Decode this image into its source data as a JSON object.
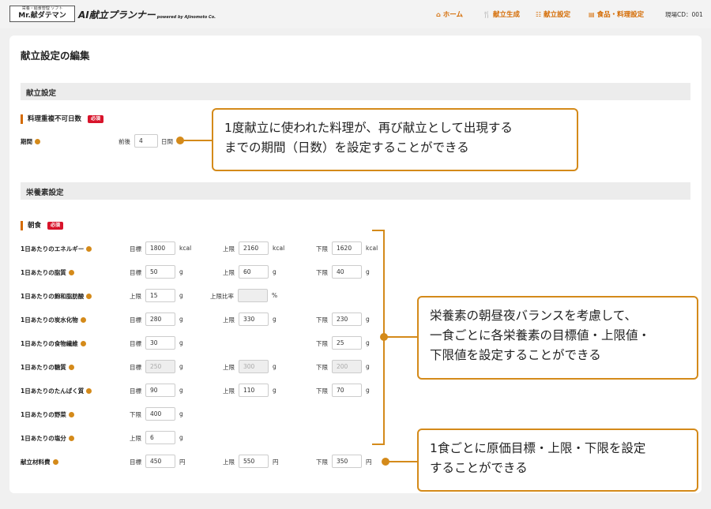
{
  "header": {
    "logo_small": "栄養・給食管理 ソフト",
    "logo_main": "Mr.献ダテマン",
    "app_title": "AI献立プランナー",
    "app_powered": "powered by Ajinomoto Co.",
    "nav": [
      {
        "label": "ホーム",
        "icon": "home-icon",
        "glyph": "⌂"
      },
      {
        "label": "献立生成",
        "icon": "utensils-icon",
        "glyph": "🍴"
      },
      {
        "label": "献立設定",
        "icon": "settings-list-icon",
        "glyph": "☷"
      },
      {
        "label": "食品・料理設定",
        "icon": "food-settings-icon",
        "glyph": "▤"
      }
    ],
    "site_cd": "現場CD：001"
  },
  "page": {
    "title": "献立設定の編集"
  },
  "menu_settings": {
    "heading": "献立設定",
    "sub_heading": "料理重複不可日数",
    "required": "必須",
    "period": {
      "label": "期間",
      "prefix": "前後",
      "value": "4",
      "unit": "日間"
    }
  },
  "nutrition": {
    "heading": "栄養素設定",
    "meal": "朝食",
    "required": "必須",
    "rows": [
      {
        "label": "1日あたりのエネルギー",
        "fields": [
          {
            "label": "目標",
            "value": "1800",
            "unit": "kcal"
          },
          {
            "label": "上限",
            "value": "2160",
            "unit": "kcal"
          },
          {
            "label": "下限",
            "value": "1620",
            "unit": "kcal"
          }
        ]
      },
      {
        "label": "1日あたりの脂質",
        "fields": [
          {
            "label": "目標",
            "value": "50",
            "unit": "g"
          },
          {
            "label": "上限",
            "value": "60",
            "unit": "g"
          },
          {
            "label": "下限",
            "value": "40",
            "unit": "g"
          }
        ]
      },
      {
        "label": "1日あたりの飽和脂肪酸",
        "fields": [
          {
            "label": "上限",
            "value": "15",
            "unit": "g"
          },
          {
            "label": "上限比率",
            "value": "",
            "unit": "%",
            "disabled": true
          }
        ]
      },
      {
        "label": "1日あたりの炭水化物",
        "fields": [
          {
            "label": "目標",
            "value": "280",
            "unit": "g"
          },
          {
            "label": "上限",
            "value": "330",
            "unit": "g"
          },
          {
            "label": "下限",
            "value": "230",
            "unit": "g"
          }
        ]
      },
      {
        "label": "1日あたりの食物繊維",
        "fields": [
          {
            "label": "目標",
            "value": "30",
            "unit": "g"
          },
          {
            "label": "下限",
            "value": "25",
            "unit": "g"
          }
        ]
      },
      {
        "label": "1日あたりの糖質",
        "fields": [
          {
            "label": "目標",
            "value": "250",
            "unit": "g",
            "disabled": true
          },
          {
            "label": "上限",
            "value": "300",
            "unit": "g",
            "disabled": true
          },
          {
            "label": "下限",
            "value": "200",
            "unit": "g",
            "disabled": true
          }
        ]
      },
      {
        "label": "1日あたりのたんぱく質",
        "fields": [
          {
            "label": "目標",
            "value": "90",
            "unit": "g"
          },
          {
            "label": "上限",
            "value": "110",
            "unit": "g"
          },
          {
            "label": "下限",
            "value": "70",
            "unit": "g"
          }
        ]
      },
      {
        "label": "1日あたりの野菜",
        "fields": [
          {
            "label": "下限",
            "value": "400",
            "unit": "g"
          }
        ]
      },
      {
        "label": "1日あたりの塩分",
        "fields": [
          {
            "label": "上限",
            "value": "6",
            "unit": "g"
          }
        ]
      },
      {
        "label": "献立材料費",
        "fields": [
          {
            "label": "目標",
            "value": "450",
            "unit": "円"
          },
          {
            "label": "上限",
            "value": "550",
            "unit": "円"
          },
          {
            "label": "下限",
            "value": "350",
            "unit": "円"
          }
        ]
      }
    ]
  },
  "callouts": {
    "period": [
      "1度献立に使われた料理が、再び献立として出現する",
      "までの期間（日数）を設定することができる"
    ],
    "nutrition": [
      "栄養素の朝昼夜バランスを考慮して、",
      "一食ごとに各栄養素の目標値・上限値・",
      "下限値を設定することができる"
    ],
    "cost": [
      "1食ごとに原価目標・上限・下限を設定",
      "することができる"
    ]
  },
  "colors": {
    "accent": "#d46a00",
    "callout_border": "#d48a1a",
    "required_bg": "#d8142b"
  }
}
